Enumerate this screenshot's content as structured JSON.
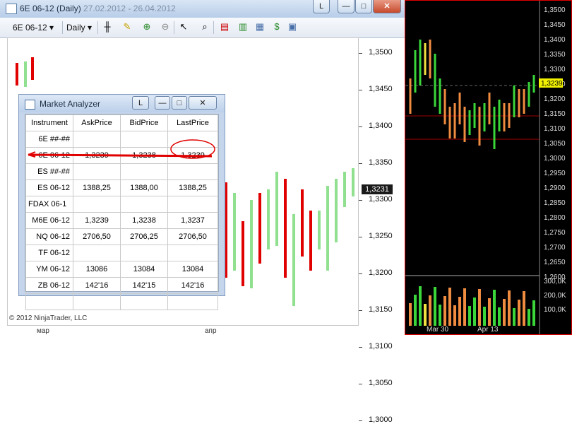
{
  "chart_window": {
    "title_symbol": "6E 06-12 (Daily)",
    "title_dates": "27.02.2012 - 26.04.2012",
    "link_button": "L",
    "min_button": "—",
    "max_button": "□",
    "close_button": "✕"
  },
  "toolbar": {
    "instrument": "6E 06-12",
    "period": "Daily"
  },
  "price_axis": {
    "labels": [
      "1,3500",
      "1,3450",
      "1,3400",
      "1,3350",
      "1,3300",
      "1,3250",
      "1,3200",
      "1,3150",
      "1,3100",
      "1,3050",
      "1,3000"
    ],
    "current_price": "1,3231"
  },
  "x_axis": {
    "labels": [
      "мар",
      "апр"
    ]
  },
  "copyright": "© 2012 NinjaTrader, LLC",
  "market_analyzer": {
    "title": "Market Analyzer",
    "link_button": "L",
    "columns": [
      "Instrument",
      "AskPrice",
      "BidPrice",
      "LastPrice"
    ],
    "rows": [
      {
        "instrument": "6E ##-##",
        "ask": "",
        "bid": "",
        "last": ""
      },
      {
        "instrument": "6E 06-12",
        "ask": "1,3239",
        "bid": "1,3238",
        "last": "1,3239"
      },
      {
        "instrument": "ES ##-##",
        "ask": "",
        "bid": "",
        "last": ""
      },
      {
        "instrument": "ES 06-12",
        "ask": "1388,25",
        "bid": "1388,00",
        "last": "1388,25"
      },
      {
        "instrument": "FDAX 06-1",
        "ask": "",
        "bid": "",
        "last": ""
      },
      {
        "instrument": "M6E 06-12",
        "ask": "1,3239",
        "bid": "1,3238",
        "last": "1,3237"
      },
      {
        "instrument": "NQ 06-12",
        "ask": "2706,50",
        "bid": "2706,25",
        "last": "2706,50"
      },
      {
        "instrument": "TF 06-12",
        "ask": "",
        "bid": "",
        "last": ""
      },
      {
        "instrument": "YM 06-12",
        "ask": "13086",
        "bid": "13084",
        "last": "13084"
      },
      {
        "instrument": "ZB 06-12",
        "ask": "142'16",
        "bid": "142'15",
        "last": "142'16"
      }
    ]
  },
  "mini_chart": {
    "price_labels": [
      "1,3500",
      "1,3450",
      "1,3400",
      "1,3350",
      "1,3300",
      "1,3250",
      "1,3200",
      "1,3150",
      "1,3100",
      "1,3050",
      "1,3000",
      "1,2950",
      "1,2900",
      "1,2850",
      "1,2800",
      "1,2750",
      "1,2700",
      "1,2650",
      "1,2600"
    ],
    "current_price": "1,3239",
    "volume_labels": [
      "300,0K",
      "200,0K",
      "100,0K"
    ],
    "date_labels": [
      "Mar 30",
      "Apr 13"
    ]
  },
  "colors": {
    "up": "#90e090",
    "down": "#e00000",
    "mini_up": "#3ad63a",
    "mini_down": "#f08c40",
    "mini_mid": "#f0e040"
  }
}
